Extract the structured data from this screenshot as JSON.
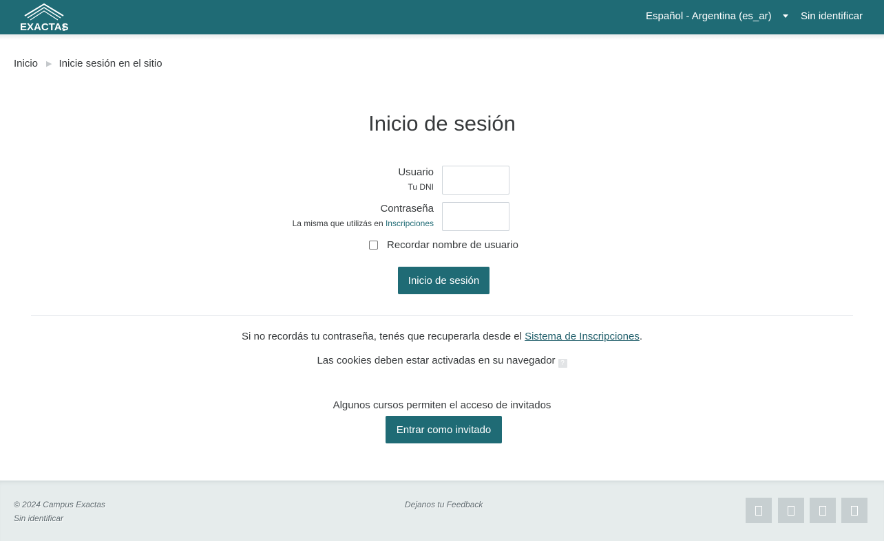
{
  "navbar": {
    "logo_text": "EXACTAS",
    "logo_side_text": "UBA",
    "language": "Español - Argentina (es_ar)",
    "user_status": "Sin identificar"
  },
  "breadcrumb": {
    "home": "Inicio",
    "current": "Inicie sesión en el sitio"
  },
  "login": {
    "title": "Inicio de sesión",
    "username_label": "Usuario",
    "username_help": "Tu DNI",
    "username_value": "",
    "password_label": "Contraseña",
    "password_help_prefix": "La misma que utilizás en ",
    "password_help_link": "Inscripciones",
    "password_value": "",
    "remember_label": "Recordar nombre de usuario",
    "remember_checked": false,
    "submit_label": "Inicio de sesión"
  },
  "info": {
    "forgot_prefix": "Si no recordás tu contraseña, tenés que recuperarla desde el ",
    "forgot_link": "Sistema de Inscripciones",
    "forgot_suffix": ".",
    "cookies_text": "Las cookies deben estar activadas en su navegador",
    "guest_text": "Algunos cursos permiten el acceso de invitados",
    "guest_button": "Entrar como invitado"
  },
  "footer": {
    "copyright": "© 2024 Campus Exactas",
    "user_status": "Sin identificar",
    "feedback_link": "Dejanos tu Feedback",
    "social_icons": [
      "social-icon",
      "social-icon",
      "social-icon",
      "social-icon"
    ]
  },
  "colors": {
    "brand": "#1f6b75",
    "footer_bg": "#e6ecec"
  }
}
